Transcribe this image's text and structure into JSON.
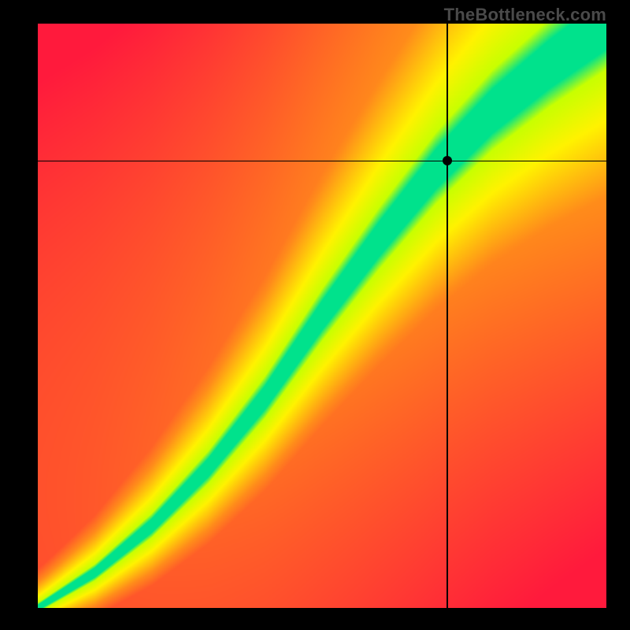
{
  "watermark": "TheBottleneck.com",
  "colors": {
    "background": "#000000",
    "marker": "#000000"
  },
  "chart_data": {
    "type": "heatmap",
    "title": "",
    "xlabel": "",
    "ylabel": "",
    "xlim": [
      0,
      1
    ],
    "ylim": [
      0,
      1
    ],
    "marker_point": {
      "x": 0.72,
      "y": 0.765
    },
    "crosshair": {
      "x": 0.72,
      "y": 0.765
    },
    "ridge_points": [
      {
        "x": 0.0,
        "y": 0.0
      },
      {
        "x": 0.1,
        "y": 0.06
      },
      {
        "x": 0.2,
        "y": 0.14
      },
      {
        "x": 0.3,
        "y": 0.24
      },
      {
        "x": 0.4,
        "y": 0.36
      },
      {
        "x": 0.5,
        "y": 0.5
      },
      {
        "x": 0.6,
        "y": 0.63
      },
      {
        "x": 0.7,
        "y": 0.75
      },
      {
        "x": 0.8,
        "y": 0.85
      },
      {
        "x": 0.9,
        "y": 0.93
      },
      {
        "x": 1.0,
        "y": 1.0
      }
    ],
    "color_stops": [
      {
        "t": 0.0,
        "color": "#ff1a3c"
      },
      {
        "t": 0.45,
        "color": "#ff8c1a"
      },
      {
        "t": 0.75,
        "color": "#fff200"
      },
      {
        "t": 0.93,
        "color": "#c8ff00"
      },
      {
        "t": 1.0,
        "color": "#00e28c"
      }
    ],
    "ridge_width": 0.05
  }
}
